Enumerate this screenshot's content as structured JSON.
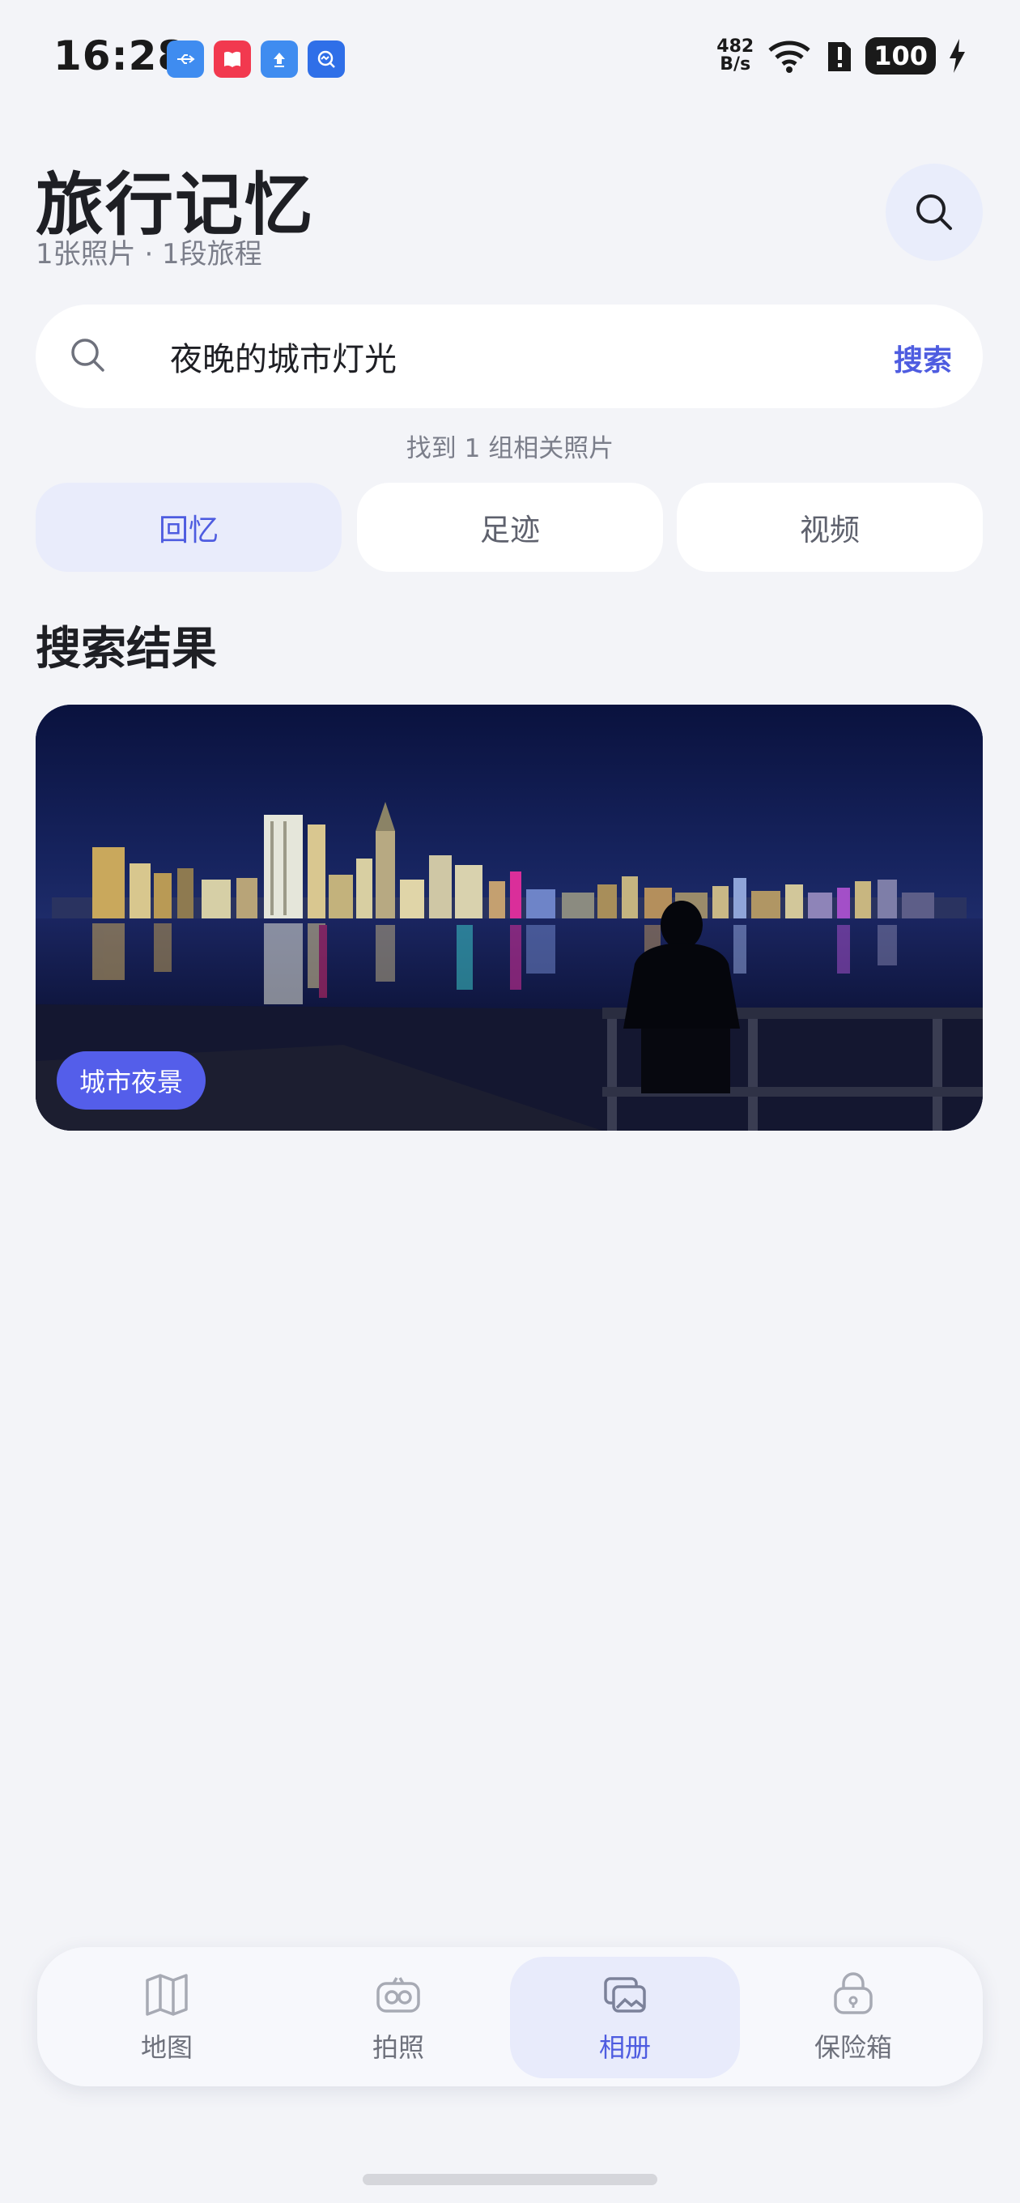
{
  "status_bar": {
    "time": "16:28",
    "net_speed_value": "482",
    "net_speed_unit": "B/s",
    "battery": "100",
    "notification_icons": [
      "usb-icon",
      "book-icon",
      "upload-icon",
      "search-app-icon"
    ]
  },
  "header": {
    "title": "旅行记忆",
    "subtitle": "1张照片 · 1段旅程"
  },
  "search": {
    "value": "夜晚的城市灯光",
    "submit_label": "搜索",
    "result_count": "找到 1 组相关照片"
  },
  "tabs": [
    {
      "label": "回忆",
      "active": true
    },
    {
      "label": "足迹",
      "active": false
    },
    {
      "label": "视频",
      "active": false
    }
  ],
  "section_title": "搜索结果",
  "results": [
    {
      "tag": "城市夜景"
    }
  ],
  "bottom_nav": [
    {
      "label": "地图",
      "icon": "map-icon",
      "active": false
    },
    {
      "label": "拍照",
      "icon": "camera-icon",
      "active": false
    },
    {
      "label": "相册",
      "icon": "album-icon",
      "active": true
    },
    {
      "label": "保险箱",
      "icon": "safe-icon",
      "active": false
    }
  ],
  "colors": {
    "accent": "#4E5CE0",
    "background": "#F3F4F8",
    "tag": "#545EEA"
  }
}
